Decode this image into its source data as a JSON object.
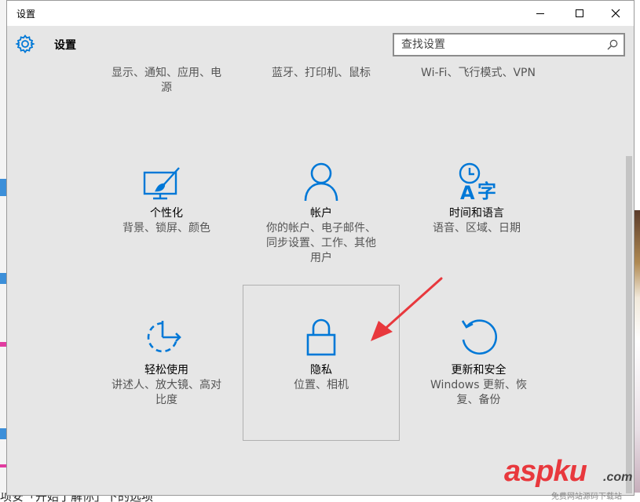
{
  "window": {
    "title": "设置",
    "header_title": "设置",
    "search_placeholder": "查找设置"
  },
  "top_row": [
    {
      "desc_line1": "显示、通知、应用、电",
      "desc_line2": "源"
    },
    {
      "desc_line1": "蓝牙、打印机、鼠标"
    },
    {
      "desc_line1": "Wi-Fi、飞行模式、VPN"
    }
  ],
  "tiles": [
    {
      "name": "个性化",
      "desc": [
        "背景、锁屏、颜色"
      ],
      "icon": "personalization-icon"
    },
    {
      "name": "帐户",
      "desc": [
        "你的帐户、电子邮件、",
        "同步设置、工作、其他",
        "用户"
      ],
      "icon": "account-icon"
    },
    {
      "name": "时间和语言",
      "desc": [
        "语音、区域、日期"
      ],
      "icon": "time-language-icon"
    },
    {
      "name": "轻松使用",
      "desc": [
        "讲述人、放大镜、高对",
        "比度"
      ],
      "icon": "ease-of-access-icon"
    },
    {
      "name": "隐私",
      "desc": [
        "位置、相机"
      ],
      "icon": "lock-icon"
    },
    {
      "name": "更新和安全",
      "desc": [
        "Windows 更新、恢",
        "复、备份"
      ],
      "icon": "update-icon"
    }
  ],
  "background_text": "项安「开始了解你」下的选项",
  "watermark": {
    "main_a": "asp",
    "main_b": "ku",
    "com": ".com",
    "sub": "免费网站源码下载站"
  },
  "colors": {
    "accent": "#0078d7",
    "arrow": "#e8383d",
    "window_bg": "#e6e6e6"
  }
}
